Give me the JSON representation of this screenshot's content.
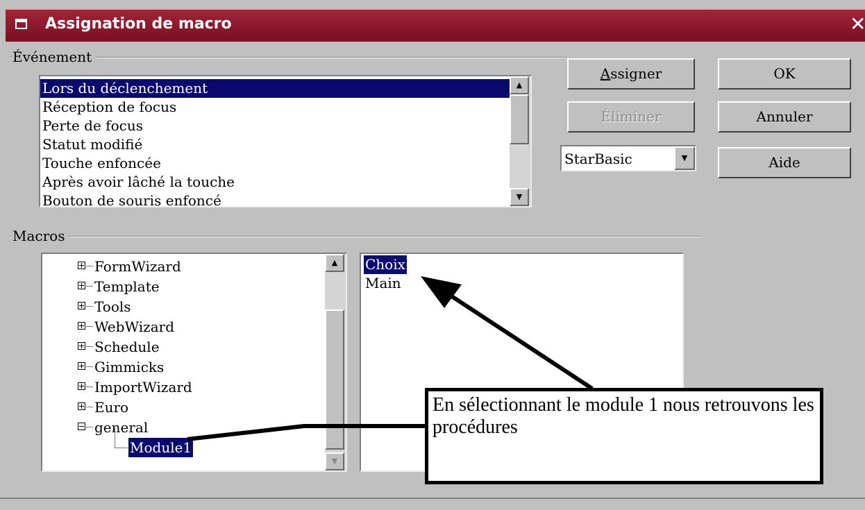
{
  "window": {
    "title": "Assignation de macro",
    "close_glyph": "✕"
  },
  "event_group": {
    "label": "Événement",
    "items": [
      {
        "label": "Lors du déclenchement",
        "selected": true
      },
      {
        "label": "Réception de focus"
      },
      {
        "label": "Perte de focus"
      },
      {
        "label": "Statut modifié"
      },
      {
        "label": "Touche enfoncée"
      },
      {
        "label": "Après avoir lâché la touche"
      },
      {
        "label": "Bouton de souris enfoncé"
      }
    ]
  },
  "buttons": {
    "assign": "Assigner",
    "remove": "Éliminer",
    "ok": "OK",
    "cancel": "Annuler",
    "help": "Aide"
  },
  "language_select": {
    "value": "StarBasic"
  },
  "macros_group": {
    "label": "Macros",
    "tree": [
      {
        "label": "FormWizard",
        "expander": "plus"
      },
      {
        "label": "Template",
        "expander": "plus"
      },
      {
        "label": "Tools",
        "expander": "plus"
      },
      {
        "label": "WebWizard",
        "expander": "plus"
      },
      {
        "label": "Schedule",
        "expander": "plus"
      },
      {
        "label": "Gimmicks",
        "expander": "plus"
      },
      {
        "label": "ImportWizard",
        "expander": "plus"
      },
      {
        "label": "Euro",
        "expander": "plus"
      },
      {
        "label": "general",
        "expander": "minus"
      },
      {
        "label": "Module1",
        "selected": true
      }
    ],
    "procedures": [
      {
        "label": "Choix",
        "selected": true
      },
      {
        "label": "Main"
      }
    ]
  },
  "annotation": {
    "text": " En sélectionnant le module 1 nous retrouvons les procédures"
  }
}
